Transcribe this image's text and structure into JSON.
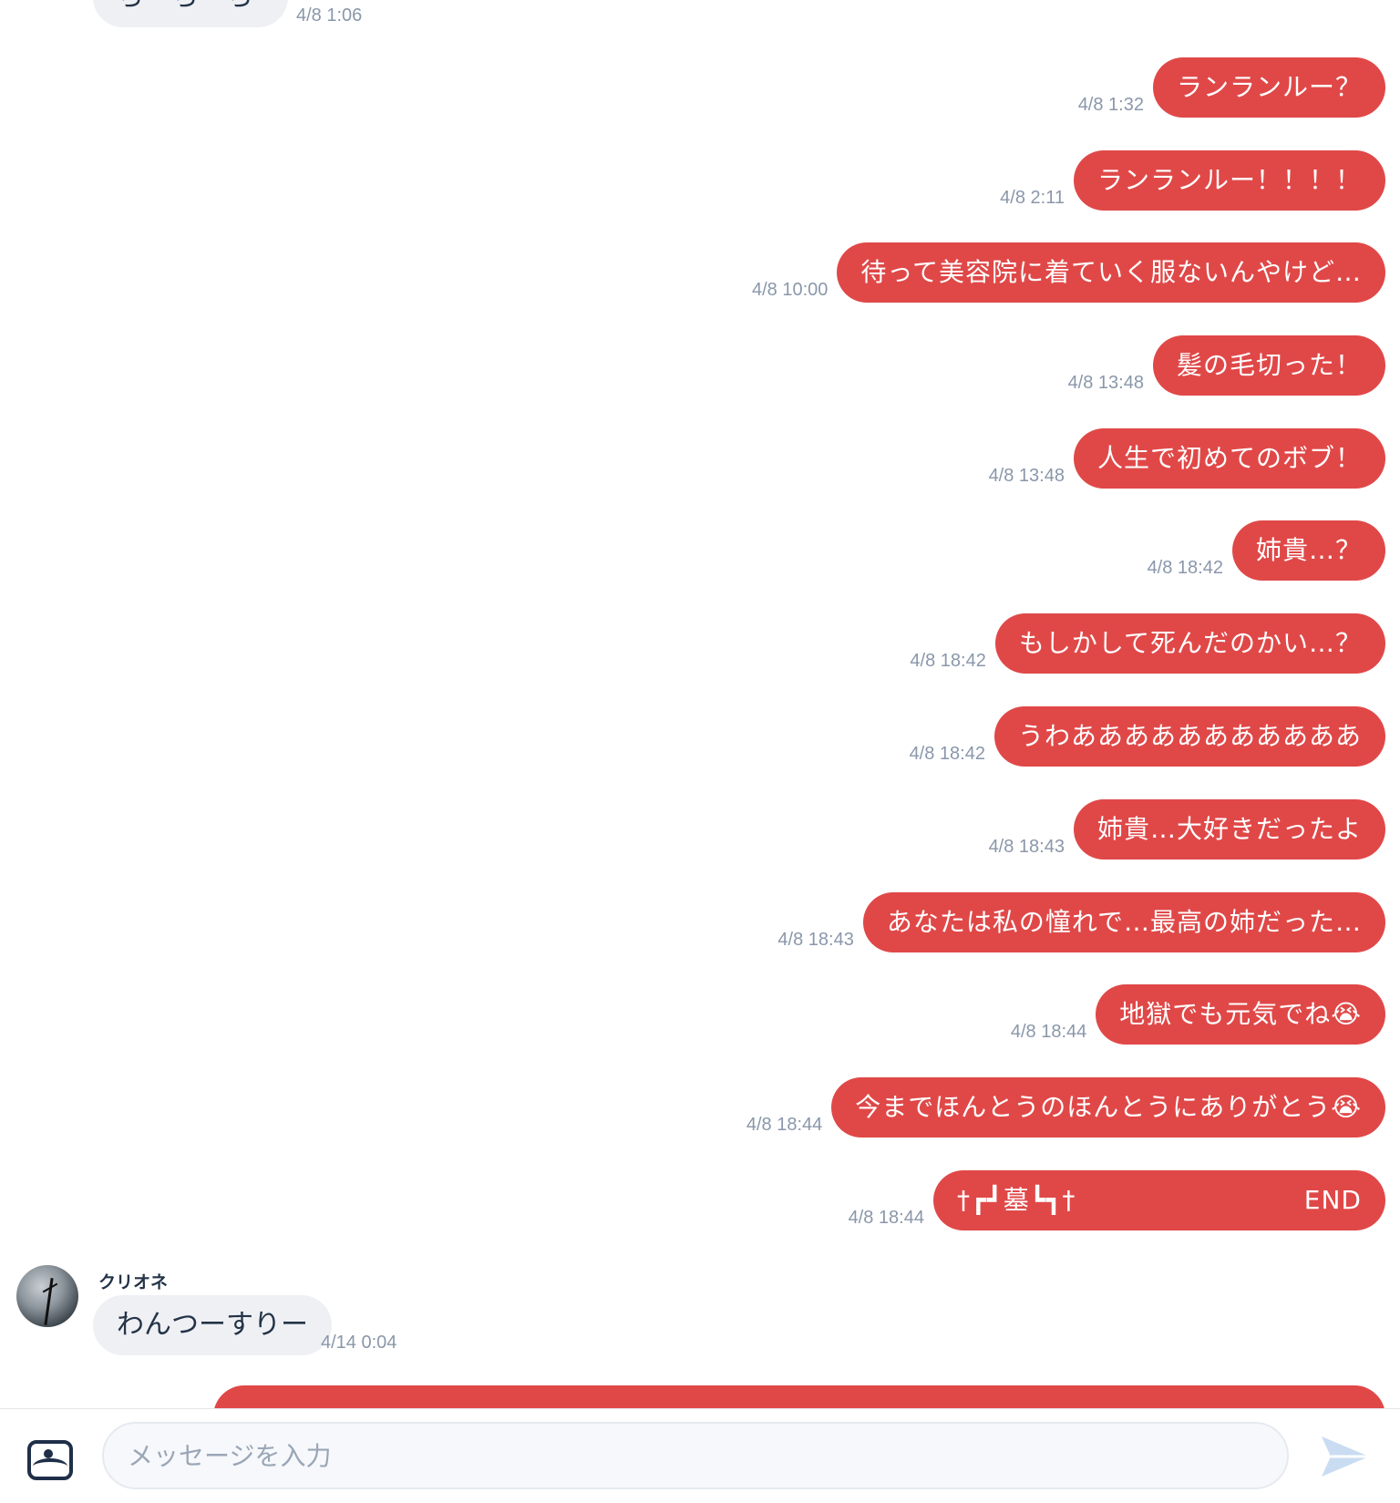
{
  "incoming_top": {
    "text": "ち〜ち〜ち",
    "time": "4/8 1:06"
  },
  "outgoing": [
    {
      "text": "ランランルー？",
      "time": "4/8 1:32"
    },
    {
      "text": "ランランルー！！！！",
      "time": "4/8 2:11"
    },
    {
      "text": "待って美容院に着ていく服ないんやけど…",
      "time": "4/8 10:00"
    },
    {
      "text": "髪の毛切った！",
      "time": "4/8 13:48"
    },
    {
      "text": "人生で初めてのボブ！",
      "time": "4/8 13:48"
    },
    {
      "text": "姉貴…？",
      "time": "4/8 18:42"
    },
    {
      "text": "もしかして死んだのかい…？",
      "time": "4/8 18:42"
    },
    {
      "text": "うわあああああああああああ",
      "time": "4/8 18:42"
    },
    {
      "text": "姉貴…大好きだったよ",
      "time": "4/8 18:43"
    },
    {
      "text": "あなたは私の憧れで…最高の姉だった…",
      "time": "4/8 18:43"
    },
    {
      "text": "地獄でも元気でね😭",
      "time": "4/8 18:44"
    },
    {
      "text": "今までほんとうのほんとうにありがとう😭",
      "time": "4/8 18:44"
    }
  ],
  "end_message": {
    "left": "†┏┛墓┗┓†",
    "right": "END",
    "time": "4/8 18:44"
  },
  "incoming_bottom": {
    "sender": "クリオネ",
    "text": "わんつーすりー",
    "time": "4/14 0:04"
  },
  "composer": {
    "placeholder": "メッセージを入力"
  },
  "colors": {
    "outgoing_bubble": "#e04848",
    "incoming_bubble": "#eef0f4",
    "timestamp": "#8a97aa"
  },
  "icons": {
    "image_button": "image-icon",
    "send_button": "send-icon"
  }
}
